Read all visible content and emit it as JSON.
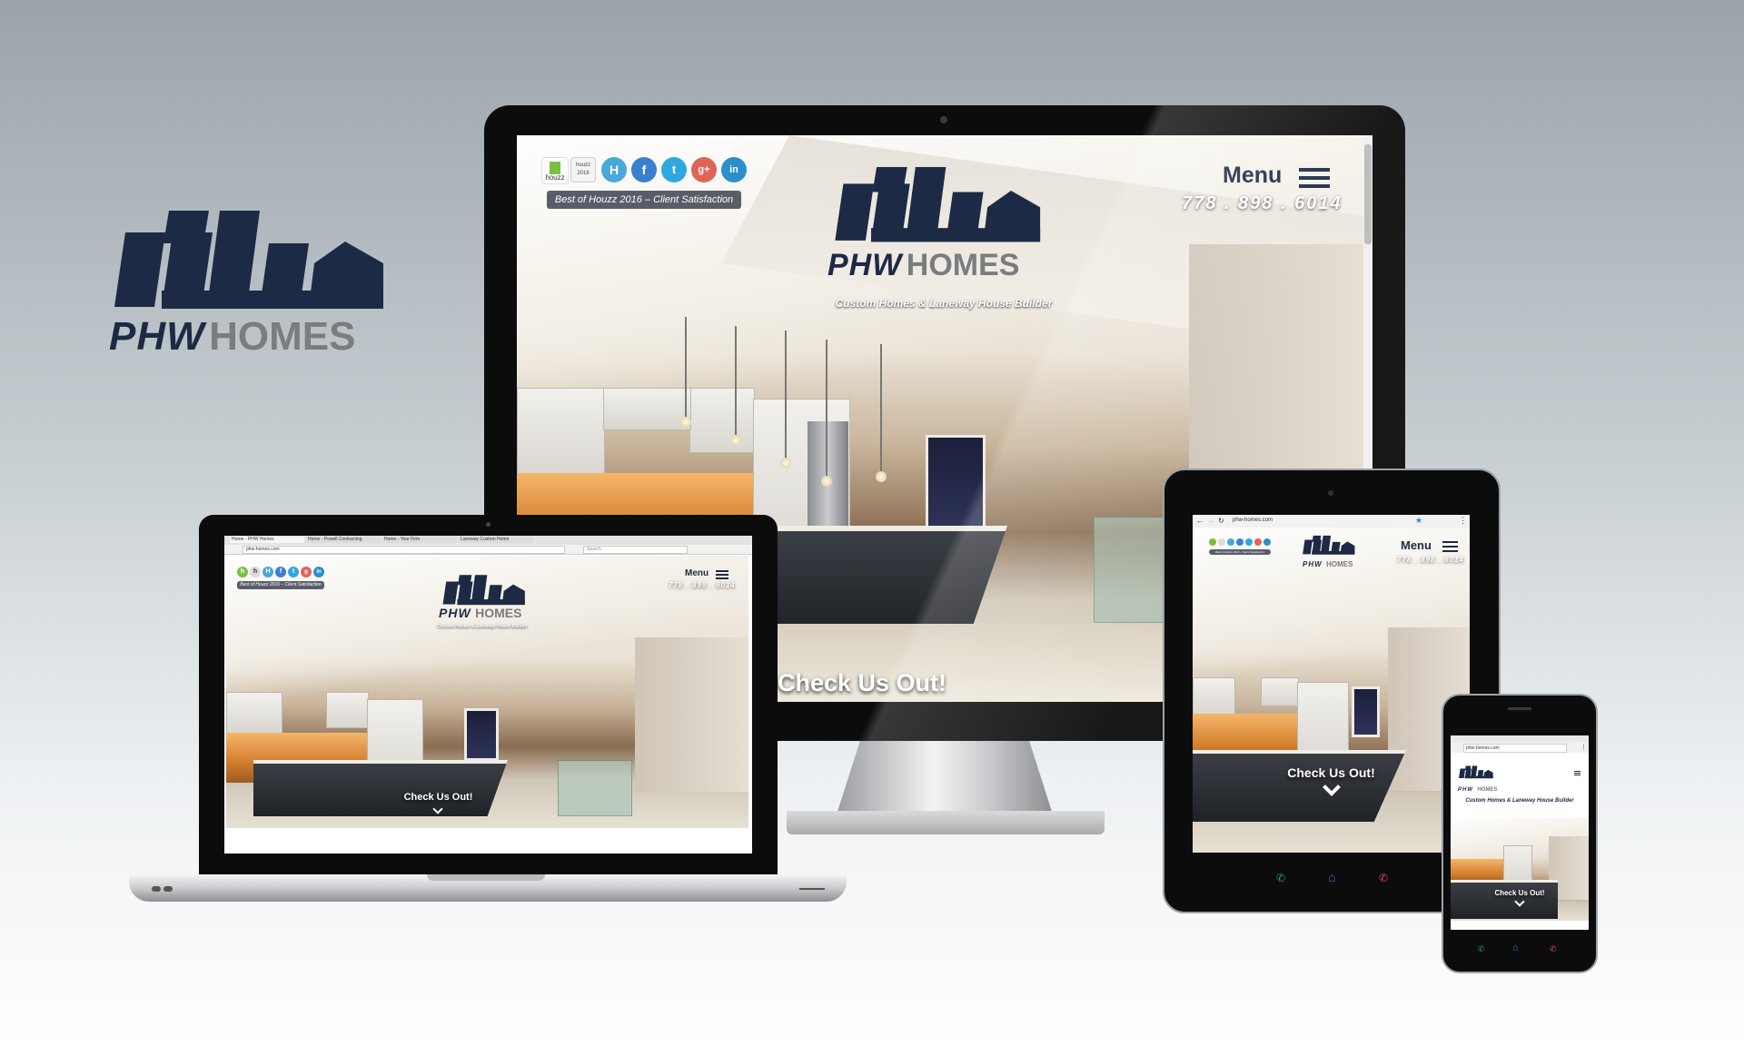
{
  "brand": {
    "name_part1": "PHW",
    "name_part2": "HOMES",
    "tagline": "Custom Homes & Laneway House Builder"
  },
  "site": {
    "menu_label": "Menu",
    "phone": "778 . 898 . 6014",
    "houzz_badge": "Best of Houzz 2016 – Client Satisfaction",
    "houzz_logo_text": "houzz",
    "houzz_award_text": "houzz 2016",
    "cta_label": "Check Us Out!",
    "url": "phw-homes.com"
  },
  "social_icons": [
    {
      "name": "houzz-h-icon",
      "glyph": "H",
      "color": "#4aa8d8"
    },
    {
      "name": "facebook-icon",
      "glyph": "f",
      "color": "#3b7fd1"
    },
    {
      "name": "twitter-icon",
      "glyph": "t",
      "color": "#2fa8e0"
    },
    {
      "name": "google-plus-icon",
      "glyph": "g+",
      "color": "#e0635a"
    },
    {
      "name": "linkedin-icon",
      "glyph": "in",
      "color": "#2c8fc9"
    }
  ],
  "laptop_browser": {
    "tabs": [
      "Home - PHW Homes",
      "Home - Powell Contracting",
      "Home - Your Firm",
      "Laneway Custom Home"
    ],
    "search_placeholder": "Search"
  },
  "colors": {
    "brand_navy": "#1c2a45",
    "brand_grey": "#7a7d80"
  }
}
